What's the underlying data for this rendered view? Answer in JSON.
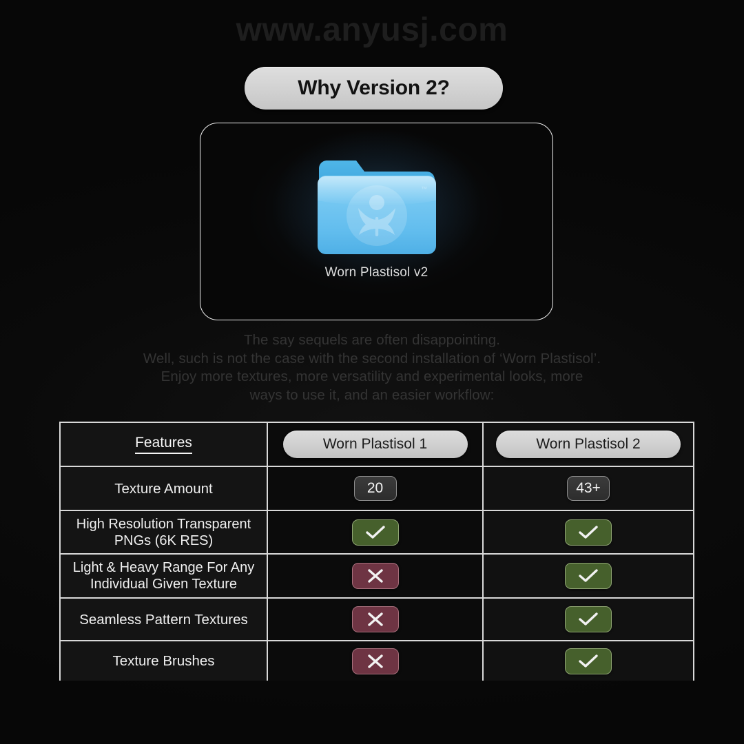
{
  "watermark": {
    "text": "www.anyusj.com",
    "occurrences": 3,
    "color": "#1e1e1e"
  },
  "header": {
    "title": "Why Version 2?"
  },
  "folder_panel": {
    "folder_icon_name": "blue-folder-icon",
    "folder_label": "Worn Plastisol v2",
    "folder_color": "#5cc2f0",
    "folder_color_dark": "#3aa8e0"
  },
  "description": {
    "lines": [
      "The say sequels are often disappointing.",
      "Well, such is not the case with the second installation of ‘Worn Plastisol’.",
      "Enjoy more textures, more versatility and experimental looks, more",
      "ways to use it, and an easier workflow:"
    ]
  },
  "comparison_table": {
    "columns": {
      "features_header": "Features",
      "v1_header": "Worn Plastisol 1",
      "v2_header": "Worn Plastisol 2"
    },
    "rows": [
      {
        "feature": "Texture Amount",
        "feature_line2": "",
        "v1_type": "value",
        "v1_value": "20",
        "v2_type": "value",
        "v2_value": "43+"
      },
      {
        "feature": "High Resolution Transparent",
        "feature_line2": "PNGs (6K RES)",
        "v1_type": "yes",
        "v1_value": "✓",
        "v2_type": "yes",
        "v2_value": "✓"
      },
      {
        "feature": "Light & Heavy Range For Any",
        "feature_line2": "Individual Given Texture",
        "v1_type": "no",
        "v1_value": "✕",
        "v2_type": "yes",
        "v2_value": "✓"
      },
      {
        "feature": "Seamless Pattern Textures",
        "feature_line2": "",
        "v1_type": "no",
        "v1_value": "✕",
        "v2_type": "yes",
        "v2_value": "✓"
      },
      {
        "feature": "Texture Brushes",
        "feature_line2": "",
        "v1_type": "no",
        "v1_value": "✕",
        "v2_type": "yes",
        "v2_value": "✓"
      }
    ]
  },
  "colors": {
    "background": "#080808",
    "border": "#d9d9d9",
    "yes_badge": "#46602c",
    "yes_badge_border": "#8fa573",
    "no_badge": "#6e3443",
    "no_badge_border": "#a7707c",
    "pill": "#d2d2d2",
    "text": "#f0f0f0",
    "desc_text": "#343434"
  }
}
